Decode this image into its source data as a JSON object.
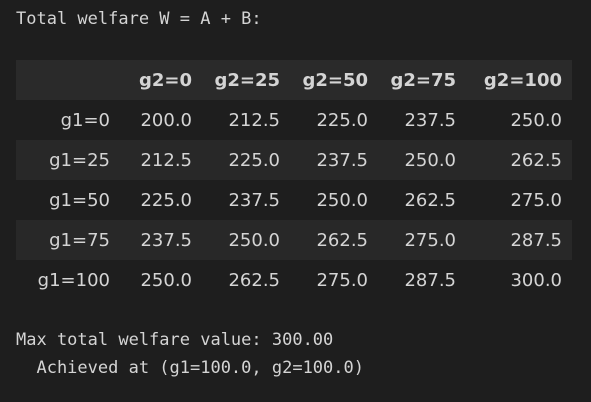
{
  "output": {
    "heading": "Total welfare W = A + B:",
    "table": {
      "corner": "",
      "columns": [
        "g2=0",
        "g2=25",
        "g2=50",
        "g2=75",
        "g2=100"
      ],
      "rows": [
        {
          "label": "g1=0",
          "values": [
            "200.0",
            "212.5",
            "225.0",
            "237.5",
            "250.0"
          ]
        },
        {
          "label": "g1=25",
          "values": [
            "212.5",
            "225.0",
            "237.5",
            "250.0",
            "262.5"
          ]
        },
        {
          "label": "g1=50",
          "values": [
            "225.0",
            "237.5",
            "250.0",
            "262.5",
            "275.0"
          ]
        },
        {
          "label": "g1=75",
          "values": [
            "237.5",
            "250.0",
            "262.5",
            "275.0",
            "287.5"
          ]
        },
        {
          "label": "g1=100",
          "values": [
            "250.0",
            "262.5",
            "275.0",
            "287.5",
            "300.0"
          ]
        }
      ]
    },
    "max_line": "Max total welfare value: 300.00",
    "achieved_line": "  Achieved at (g1=100.0, g2=100.0)"
  },
  "colors": {
    "background": "#1e1e1e",
    "text": "#d4d4d4",
    "header_row": "#2a2a2a",
    "striped_row": "#282828"
  }
}
